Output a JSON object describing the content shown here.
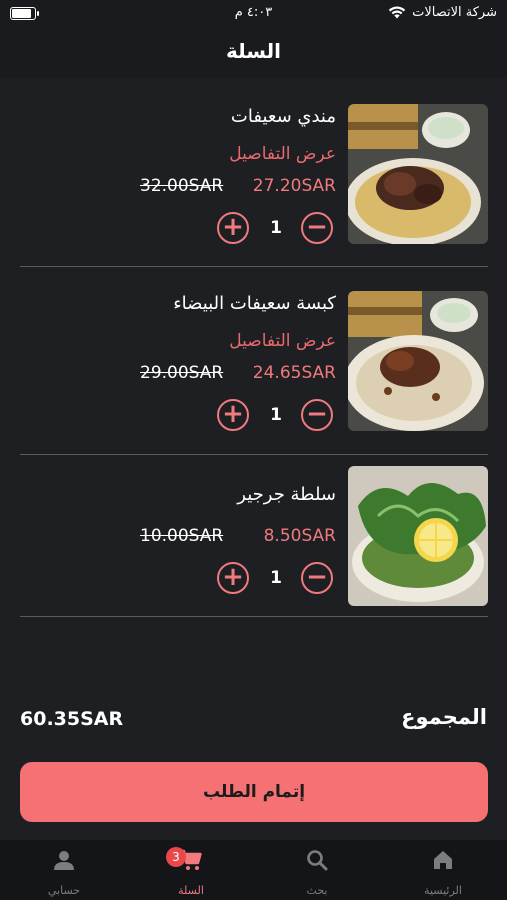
{
  "status_bar": {
    "carrier": "شركة الاتصالات",
    "time": "٤:٠٣ م",
    "battery_level": 0.9
  },
  "header": {
    "title": "السلة"
  },
  "cart": {
    "items": [
      {
        "name": "مندي سعيفات",
        "details_label": "عرض التفاصيل",
        "price_new": "27.20SAR",
        "price_old": "32.00SAR",
        "quantity": "1",
        "image_icon": "mandi-chicken-rice-image"
      },
      {
        "name": "كبسة سعيفات البيضاء",
        "details_label": "عرض التفاصيل",
        "price_new": "24.65SAR",
        "price_old": "29.00SAR",
        "quantity": "1",
        "image_icon": "kabsa-chicken-rice-image"
      },
      {
        "name": "سلطة جرجير",
        "price_new": "8.50SAR",
        "price_old": "10.00SAR",
        "quantity": "1",
        "image_icon": "arugula-salad-image"
      }
    ]
  },
  "summary": {
    "total_label": "المجموع",
    "total_value": "60.35SAR",
    "checkout_label": "إتمام الطلب"
  },
  "tab_bar": {
    "tabs": [
      {
        "label": "الرئيسية",
        "icon": "home-icon"
      },
      {
        "label": "بحث",
        "icon": "search-icon"
      },
      {
        "label": "السلة",
        "icon": "cart-icon",
        "badge": "3",
        "active": true
      },
      {
        "label": "حسابي",
        "icon": "person-icon"
      }
    ]
  },
  "colors": {
    "accent": "#f07a7e",
    "checkout_button": "#f57174",
    "background": "#1e1f22",
    "badge": "#e8474b"
  }
}
